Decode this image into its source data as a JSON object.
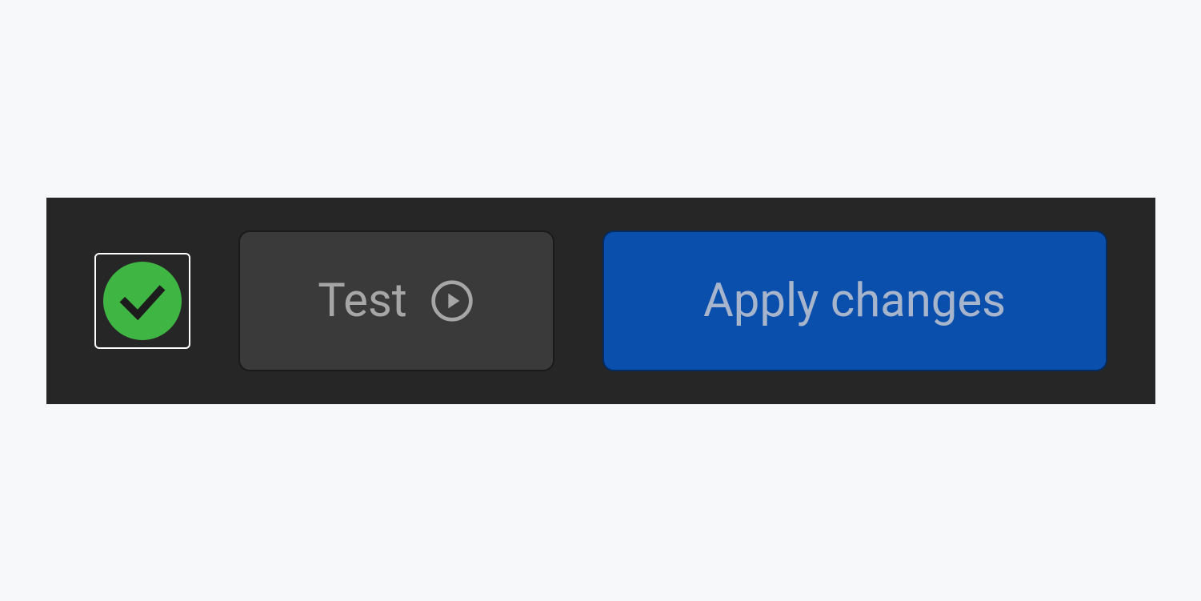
{
  "toolbar": {
    "status": "success",
    "test_label": "Test",
    "apply_label": "Apply changes"
  },
  "colors": {
    "success": "#3fb544",
    "primary": "#0b4fad",
    "panel_bg": "#262626",
    "button_bg": "#3a3a3a"
  }
}
